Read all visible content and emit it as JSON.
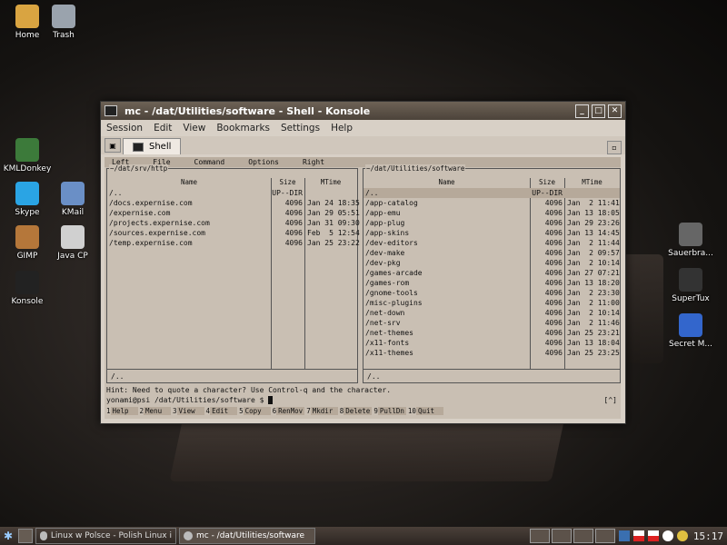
{
  "desktop": {
    "left_icons": [
      {
        "label": "Home",
        "icon": "home-icon",
        "color": "#d9a441"
      },
      {
        "label": "Trash",
        "icon": "trash-icon",
        "color": "#9aa3ad"
      },
      {
        "label": "KMLDonkey",
        "icon": "donkey-icon",
        "color": "#3c7a3a"
      },
      {
        "label": "Skype",
        "icon": "skype-icon",
        "color": "#2aa4e4"
      },
      {
        "label": "KMail",
        "icon": "kmail-icon",
        "color": "#6a8fc6"
      },
      {
        "label": "GIMP",
        "icon": "gimp-icon",
        "color": "#b5773a"
      },
      {
        "label": "Java CP",
        "icon": "java-icon",
        "color": "#d0d0d0"
      },
      {
        "label": "Konsole",
        "icon": "konsole-icon",
        "color": "#222222"
      }
    ],
    "right_icons": [
      {
        "label": "Sauerbra...",
        "icon": "sauerbraten-icon",
        "color": "#666666"
      },
      {
        "label": "SuperTux",
        "icon": "supertux-icon",
        "color": "#333333"
      },
      {
        "label": "Secret M...",
        "icon": "mushroom-icon",
        "color": "#3366cc"
      }
    ]
  },
  "window": {
    "title": "mc - /dat/Utilities/software - Shell - Konsole",
    "menu": [
      "Session",
      "Edit",
      "View",
      "Bookmarks",
      "Settings",
      "Help"
    ],
    "tab_label": "Shell"
  },
  "mc": {
    "menu": [
      "Left",
      "File",
      "Command",
      "Options",
      "Right"
    ],
    "left": {
      "path": "~/dat/srv/http",
      "arrows": "v>",
      "header": {
        "name": "Name",
        "size": "Size",
        "mtime": "MTime"
      },
      "rows": [
        {
          "name": "/..",
          "size": "UP--DIR",
          "mtime": ""
        },
        {
          "name": "/docs.expernise.com",
          "size": "4096",
          "mtime": "Jan 24 18:35"
        },
        {
          "name": "/expernise.com",
          "size": "4096",
          "mtime": "Jan 29 05:51"
        },
        {
          "name": "/projects.expernise.com",
          "size": "4096",
          "mtime": "Jan 31 09:30"
        },
        {
          "name": "/sources.expernise.com",
          "size": "4096",
          "mtime": "Feb  5 12:54"
        },
        {
          "name": "/temp.expernise.com",
          "size": "4096",
          "mtime": "Jan 25 23:22"
        }
      ],
      "status": "/.."
    },
    "right": {
      "path": "~/dat/Utilities/software",
      "arrows": "v>",
      "header": {
        "name": "Name",
        "size": "Size",
        "mtime": "MTime"
      },
      "rows": [
        {
          "name": "/..",
          "size": "UP--DIR",
          "mtime": ""
        },
        {
          "name": "/app-catalog",
          "size": "4096",
          "mtime": "Jan  2 11:41"
        },
        {
          "name": "/app-emu",
          "size": "4096",
          "mtime": "Jan 13 18:05"
        },
        {
          "name": "/app-plug",
          "size": "4096",
          "mtime": "Jan 29 23:26"
        },
        {
          "name": "/app-skins",
          "size": "4096",
          "mtime": "Jan 13 14:45"
        },
        {
          "name": "/dev-editors",
          "size": "4096",
          "mtime": "Jan  2 11:44"
        },
        {
          "name": "/dev-make",
          "size": "4096",
          "mtime": "Jan  2 09:57"
        },
        {
          "name": "/dev-pkg",
          "size": "4096",
          "mtime": "Jan  2 10:14"
        },
        {
          "name": "/games-arcade",
          "size": "4096",
          "mtime": "Jan 27 07:21"
        },
        {
          "name": "/games-rom",
          "size": "4096",
          "mtime": "Jan 13 18:20"
        },
        {
          "name": "/gnome-tools",
          "size": "4096",
          "mtime": "Jan  2 23:30"
        },
        {
          "name": "/misc-plugins",
          "size": "4096",
          "mtime": "Jan  2 11:00"
        },
        {
          "name": "/net-down",
          "size": "4096",
          "mtime": "Jan  2 10:14"
        },
        {
          "name": "/net-srv",
          "size": "4096",
          "mtime": "Jan  2 11:46"
        },
        {
          "name": "/net-themes",
          "size": "4096",
          "mtime": "Jan 25 23:21"
        },
        {
          "name": "/x11-fonts",
          "size": "4096",
          "mtime": "Jan 13 18:04"
        },
        {
          "name": "/x11-themes",
          "size": "4096",
          "mtime": "Jan 25 23:25"
        }
      ],
      "status": "/.."
    },
    "hint": "Hint: Need to quote a character?  Use Control-q and the character.",
    "prompt": "yonami@psi /dat/Utilities/software $",
    "prompt_right": "[^]",
    "fkeys": [
      {
        "num": "1",
        "label": "Help"
      },
      {
        "num": "2",
        "label": "Menu"
      },
      {
        "num": "3",
        "label": "View"
      },
      {
        "num": "4",
        "label": "Edit"
      },
      {
        "num": "5",
        "label": "Copy"
      },
      {
        "num": "6",
        "label": "RenMov"
      },
      {
        "num": "7",
        "label": "Mkdir"
      },
      {
        "num": "8",
        "label": "Delete"
      },
      {
        "num": "9",
        "label": "PullDn"
      },
      {
        "num": "10",
        "label": "Quit"
      }
    ]
  },
  "taskbar": {
    "tasks": [
      {
        "label": "Linux w Polsce - Polish Linux i",
        "active": false
      },
      {
        "label": "mc - /dat/Utilities/software",
        "active": true
      }
    ],
    "clock": "15:17"
  }
}
